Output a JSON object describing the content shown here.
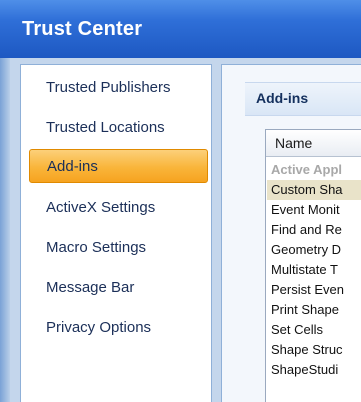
{
  "window": {
    "title": "Trust Center"
  },
  "sidebar": {
    "items": [
      {
        "label": "Trusted Publishers"
      },
      {
        "label": "Trusted Locations"
      },
      {
        "label": "Add-ins",
        "selected": true
      },
      {
        "label": "ActiveX Settings"
      },
      {
        "label": "Macro Settings"
      },
      {
        "label": "Message Bar"
      },
      {
        "label": "Privacy Options"
      }
    ]
  },
  "content": {
    "section_title": "Add-ins",
    "list": {
      "column_header": "Name",
      "group_label": "Active Appl",
      "rows": [
        "Custom Sha",
        "Event Monit",
        "Find and Re",
        "Geometry D",
        "Multistate T",
        "Persist Even",
        "Print Shape",
        "Set Cells",
        "Shape Struc",
        "ShapeStudi"
      ]
    }
  },
  "colors": {
    "titlebar": "#2f6fd8",
    "selected_item": "#f9b53a",
    "accent_border": "#8fb0d8"
  }
}
